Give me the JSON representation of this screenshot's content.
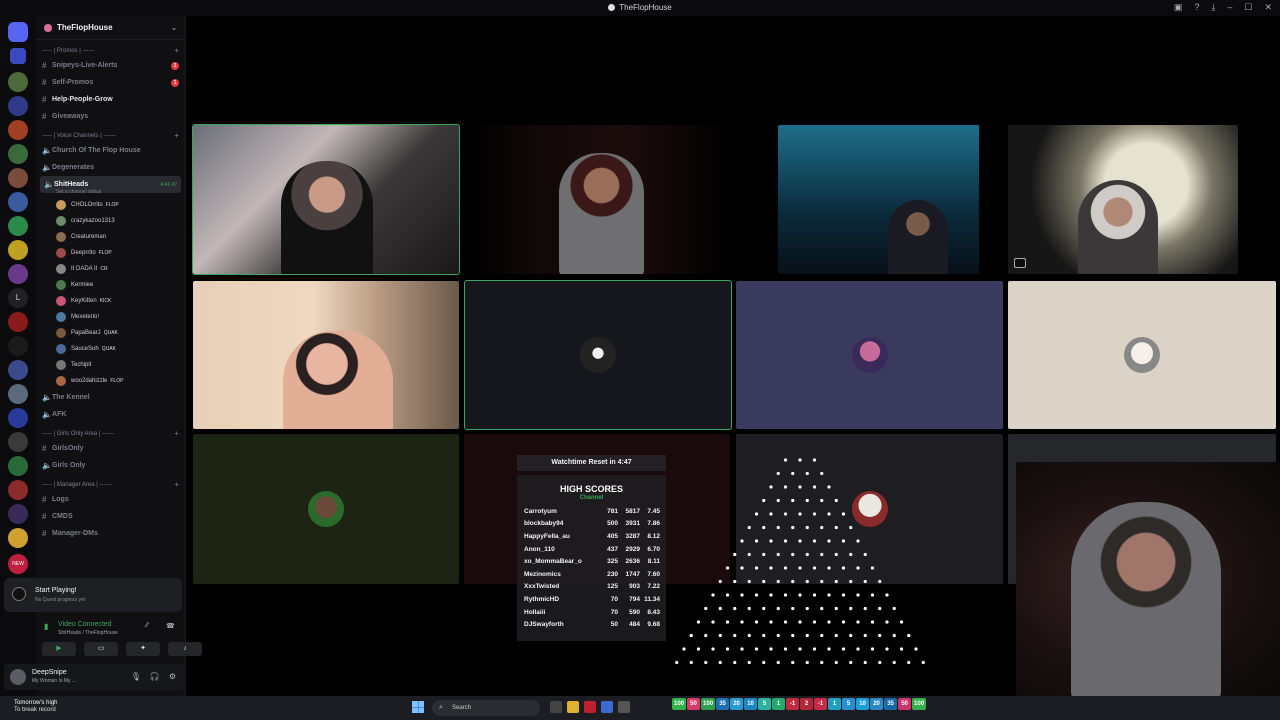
{
  "window": {
    "title": "TheFlopHouse"
  },
  "server": {
    "name": "TheFlopHouse"
  },
  "categories": {
    "promos": "----- | Promos | ------",
    "voice": "----- | Voice Channels | ------",
    "girls": "----- | Girls Only Area | ------",
    "manager": "----- | Manager Area | ------"
  },
  "channels": {
    "snipeys": "Snipeys-Live-Alerts",
    "self_promos": "Self-Promos",
    "help": "Help-People-Grow",
    "giveaways": "Giveaways",
    "church": "Church Of The Flop House",
    "degenerates": "Degenerates",
    "shitheads": "ShitHeads",
    "shitheads_time": "4:41:47",
    "shitheads_status": "Set a channel status",
    "kennel": "The Kennel",
    "afk": "AFK",
    "girlsonly1": "GirlsOnly",
    "girlsonly2": "Girls Only",
    "logs": "Logs",
    "cmds": "CMDS",
    "manager_dms": "Manager-DMs"
  },
  "voice_users": [
    {
      "name": "CHOLOrrito",
      "tag": "FLOP",
      "color": "#c89b5d"
    },
    {
      "name": "crazykazoo1313",
      "tag": "",
      "color": "#6a8d6a"
    },
    {
      "name": "Creatureman",
      "tag": "",
      "color": "#8a6d4d"
    },
    {
      "name": "Deeprrito",
      "tag": "FLOP",
      "color": "#9e4a4a"
    },
    {
      "name": "II DADA II",
      "tag": "CR",
      "color": "#888"
    },
    {
      "name": "Kermiee",
      "tag": "",
      "color": "#4d7a4d"
    },
    {
      "name": "KeyKitten",
      "tag": "KICK",
      "color": "#cc5577"
    },
    {
      "name": "Mexeterio!",
      "tag": "",
      "color": "#4a7a9e"
    },
    {
      "name": "PapaBearJ",
      "tag": "QUAK",
      "color": "#7a5a3a"
    },
    {
      "name": "SauceSuh",
      "tag": "QUAK",
      "color": "#4a6a9e"
    },
    {
      "name": "Techipit",
      "tag": "",
      "color": "#777"
    },
    {
      "name": "woo2dahizzle",
      "tag": "FLOP",
      "color": "#aa6644"
    }
  ],
  "quest": {
    "title": "Start Playing!",
    "subtitle": "No Quest progress yet"
  },
  "voice_connection": {
    "status": "Video Connected",
    "location": "ShitHeads / TheFlopHouse"
  },
  "user": {
    "name": "DeepSnipe",
    "status": "My Woman Is My ..."
  },
  "highscores": {
    "timer": "Watchtime Reset in 4:47",
    "title": "HIGH SCORES",
    "subtitle": "Channel",
    "rows": [
      [
        "Carrotyum",
        "781",
        "5817",
        "7.45"
      ],
      [
        "blockbaby94",
        "500",
        "3931",
        "7.86"
      ],
      [
        "HappyFella_au",
        "405",
        "3287",
        "8.12"
      ],
      [
        "Anon_110",
        "437",
        "2929",
        "6.70"
      ],
      [
        "xo_MommaBear_o",
        "325",
        "2636",
        "8.11"
      ],
      [
        "Mezinomics",
        "230",
        "1747",
        "7.60"
      ],
      [
        "XxxTwisted",
        "125",
        "903",
        "7.22"
      ],
      [
        "RythmicHD",
        "70",
        "794",
        "11.34"
      ],
      [
        "Hollaiii",
        "70",
        "590",
        "8.43"
      ],
      [
        "DJSwayforth",
        "50",
        "484",
        "9.68"
      ]
    ]
  },
  "taskbar": {
    "weather_line1": "Tomorrow's high",
    "weather_line2": "To break record",
    "search": "Search",
    "chips": [
      {
        "v": "100",
        "c": "#2fb34a"
      },
      {
        "v": "50",
        "c": "#d63a6a"
      },
      {
        "v": "100",
        "c": "#30a050"
      },
      {
        "v": "35",
        "c": "#1d6fb3"
      },
      {
        "v": "20",
        "c": "#2a9ad0"
      },
      {
        "v": "10",
        "c": "#1f86c4"
      },
      {
        "v": "5",
        "c": "#2cb0a0"
      },
      {
        "v": "1",
        "c": "#27a86b"
      },
      {
        "v": "-1",
        "c": "#c02a3a"
      },
      {
        "v": "2",
        "c": "#b42838"
      },
      {
        "v": "-1",
        "c": "#c62a45"
      },
      {
        "v": "1",
        "c": "#20a0c0"
      },
      {
        "v": "5",
        "c": "#2a8fd0"
      },
      {
        "v": "10",
        "c": "#1d9ed8"
      },
      {
        "v": "20",
        "c": "#2a88c8"
      },
      {
        "v": "35",
        "c": "#1b6aa8"
      },
      {
        "v": "50",
        "c": "#d0336a"
      },
      {
        "v": "100",
        "c": "#33b04a"
      }
    ]
  },
  "colors": {
    "accent": "#3ba55d",
    "danger": "#e0383e",
    "sidebar": "#101013"
  }
}
